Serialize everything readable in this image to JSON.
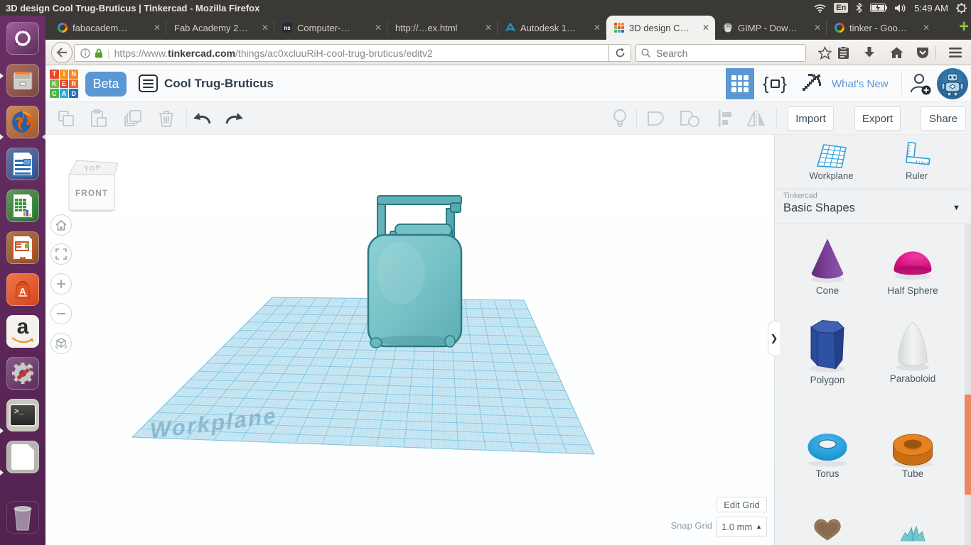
{
  "system_bar": {
    "title": "3D design Cool Trug-Bruticus | Tinkercad - Mozilla Firefox",
    "keyboard_indicator": "En",
    "time": "5:49 AM"
  },
  "launcher": {
    "items": [
      "dash",
      "files",
      "firefox",
      "libreoffice-writer",
      "libreoffice-calc",
      "libreoffice-impress",
      "ubuntu-software",
      "amazon",
      "system-settings",
      "terminal",
      "libreoffice",
      "trash"
    ],
    "amazon_glyph": "a",
    "software_glyph": "A",
    "terminal_glyph": ">_"
  },
  "browser": {
    "tab_close": "✕",
    "new_tab": "+",
    "tabs": [
      {
        "label": "fabacadem…",
        "favicon": "google"
      },
      {
        "label": "Fab Academy 2…",
        "favicon": "none"
      },
      {
        "label": "Computer-…",
        "favicon": "dark-doc",
        "favicon_text": "ns"
      },
      {
        "label": "http://…ex.html",
        "favicon": "none"
      },
      {
        "label": "Autodesk 1…",
        "favicon": "autodesk"
      },
      {
        "label": "3D design C…",
        "favicon": "tinkercad",
        "active": true
      },
      {
        "label": "GIMP - Dow…",
        "favicon": "gimp"
      },
      {
        "label": "tinker - Goo…",
        "favicon": "google"
      }
    ],
    "nav": {
      "url_scheme": "https://www.",
      "url_domain": "tinkercad.com",
      "url_path": "/things/ac0xcluuRiH-cool-trug-bruticus/editv2",
      "search_placeholder": "Search"
    }
  },
  "app_header": {
    "logo_letters": [
      "T",
      "I",
      "N",
      "K",
      "E",
      "R",
      "C",
      "A",
      "D"
    ],
    "beta_label": "Beta",
    "design_title": "Cool Trug-Bruticus",
    "whats_new": "What's New"
  },
  "edit_toolbar": {
    "import_label": "Import",
    "export_label": "Export",
    "share_label": "Share"
  },
  "canvas": {
    "viewcube_top": "TOP",
    "viewcube_front": "FRONT",
    "workplane_watermark": "Workplane",
    "edit_grid_label": "Edit Grid",
    "snap_grid_label": "Snap Grid",
    "snap_grid_value": "1.0 mm"
  },
  "icons": {
    "caret_up": "▲",
    "caret_down": "▼",
    "panel_collapse": "❯"
  },
  "shapes_panel": {
    "workplane_label": "Workplane",
    "ruler_label": "Ruler",
    "library_brand": "Tinkercad",
    "library_name": "Basic Shapes",
    "shapes": [
      {
        "label": "Cone",
        "color": "#7d3f98"
      },
      {
        "label": "Half Sphere",
        "color": "#d6127f"
      },
      {
        "label": "Polygon",
        "color": "#2e4d9e"
      },
      {
        "label": "Paraboloid",
        "color": "#e9eaea"
      },
      {
        "label": "Torus",
        "color": "#1f9ad6"
      },
      {
        "label": "Tube",
        "color": "#e8821e"
      },
      {
        "label": "",
        "color": "#9b7a5c"
      },
      {
        "label": "",
        "color": "#74c8cf"
      }
    ]
  },
  "colors": {
    "accent_blue": "#5b97d3",
    "tinkercad_icon_blue": "#2f9fd8",
    "model_teal": "#74c1c5",
    "workplane_fill": "#c9e7f3",
    "scrollbar_thumb": "#ee8660"
  }
}
